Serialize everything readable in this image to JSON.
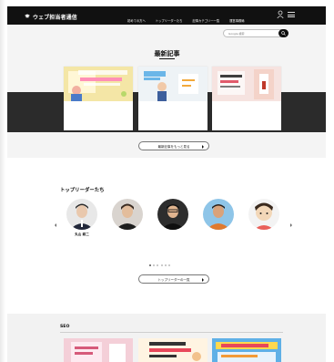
{
  "header": {
    "tagline": "",
    "site_name": "ウェブ担当者通信",
    "site_sub": "",
    "nav": [
      "初めての方へ",
      "トップリーダーたち",
      "記事カテゴリー一覧",
      "運営事務局"
    ]
  },
  "search": {
    "placeholder": "Google 検索"
  },
  "latest": {
    "title": "最新記事",
    "more_label": "最新記事をもっと見る",
    "cards": [
      {
        "thumb_title": "",
        "title": "",
        "category": "",
        "date": ""
      },
      {
        "thumb_title": "",
        "title": "",
        "category": "",
        "date": ""
      },
      {
        "thumb_title": "",
        "title": "",
        "category": "",
        "date": ""
      }
    ]
  },
  "leaders": {
    "title": "トップリーダーたち",
    "subtitle": "",
    "more_label": "トップリーダーの一覧",
    "people": [
      {
        "name": "丸山 耕二",
        "role": "",
        "desc": "",
        "link": ""
      },
      {
        "name": "",
        "role": "",
        "desc": "",
        "link": ""
      },
      {
        "name": "",
        "role": "",
        "desc": "",
        "link": ""
      },
      {
        "name": "",
        "role": "",
        "desc": "",
        "link": ""
      },
      {
        "name": "",
        "role": "",
        "desc": "",
        "link": ""
      }
    ],
    "page_count": 6,
    "active_page": 1
  },
  "seo": {
    "title": "SEO",
    "cards": [
      {
        "thumb_title": ""
      },
      {
        "thumb_title": ""
      },
      {
        "thumb_title": ""
      }
    ]
  },
  "colors": {
    "header_bg": "#111111",
    "dark_band": "#2b2b2b",
    "category": "#d44a4a",
    "link": "#3a6fc4"
  }
}
